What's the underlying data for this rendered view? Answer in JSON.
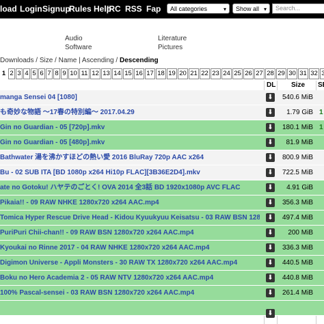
{
  "nav": [
    "load",
    "Login",
    "Signup",
    "Rules Help",
    "IRC",
    "RSS",
    "Fap"
  ],
  "filters": {
    "category": "All categories",
    "show": "Show all",
    "search_placeholder": "Search..."
  },
  "categories": [
    "Audio",
    "Software",
    "Literature",
    "Pictures"
  ],
  "breadcrumb": {
    "parts": [
      "Downloads",
      "Size",
      "Name",
      "Ascending"
    ],
    "current": "Descending"
  },
  "pages": [
    "1",
    "2",
    "3",
    "4",
    "5",
    "6",
    "7",
    "8",
    "9",
    "10",
    "11",
    "12",
    "13",
    "14",
    "15",
    "16",
    "17",
    "18",
    "19",
    "20",
    "21",
    "22",
    "23",
    "24",
    "25",
    "26",
    "27",
    "28",
    "29",
    "30",
    "31",
    "32",
    "33"
  ],
  "table": {
    "headers": {
      "dl": "DL",
      "size": "Size",
      "seed": "SE"
    },
    "rows": [
      {
        "name": "manga Sensei 04 [1080]",
        "size": "540.6 MiB",
        "seed": "",
        "style": "white"
      },
      {
        "name": "も奇妙な物語 ～17春の特別編～ 2017.04.29",
        "size": "1.79 GiB",
        "seed": "1",
        "style": "white"
      },
      {
        "name": "Gin no Guardian - 05 [720p].mkv",
        "size": "180.1 MiB",
        "seed": "1",
        "style": "green"
      },
      {
        "name": "Gin no Guardian - 05 [480p].mkv",
        "size": "81.9 MiB",
        "seed": "",
        "style": "green"
      },
      {
        "name": "Bathwater 湯を沸かすほどの熱い愛 2016 BluRay 720p AAC x264",
        "size": "800.9 MiB",
        "seed": "",
        "style": "white"
      },
      {
        "name": "Bu - 02 SUB ITA [BD 1080p x264 Hi10p FLAC][3B36E2D4].mkv",
        "size": "722.5 MiB",
        "seed": "",
        "style": "white"
      },
      {
        "name": "ate no Gotoku! ハヤテのごとく! OVA 2014 全3話 BD 1920x1080p AVC FLAC",
        "size": "4.91 GiB",
        "seed": "",
        "style": "green"
      },
      {
        "name": "Pikaia!! - 09 RAW NHKE 1280x720 x264 AAC.mp4",
        "size": "356.3 MiB",
        "seed": "",
        "style": "green"
      },
      {
        "name": "Tomica Hyper Rescue Drive Head - Kidou Kyuukyuu Keisatsu - 03 RAW BSN 1280x720 x264",
        "size": "497.4 MiB",
        "seed": "",
        "style": "green"
      },
      {
        "name": "PuriPuri Chii-chan!! - 09 RAW BSN 1280x720 x264 AAC.mp4",
        "size": "200 MiB",
        "seed": "",
        "style": "green"
      },
      {
        "name": "Kyoukai no Rinne 2017 - 04 RAW NHKE 1280x720 x264 AAC.mp4",
        "size": "336.3 MiB",
        "seed": "",
        "style": "green"
      },
      {
        "name": "Digimon Universe - Appli Monsters - 30 RAW TX 1280x720 x264 AAC.mp4",
        "size": "440.5 MiB",
        "seed": "",
        "style": "green"
      },
      {
        "name": "Boku no Hero Academia 2 - 05 RAW NTV 1280x720 x264 AAC.mp4",
        "size": "440.8 MiB",
        "seed": "",
        "style": "green"
      },
      {
        "name": "100% Pascal-sensei - 03 RAW BSN 1280x720 x264 AAC.mp4",
        "size": "261.4 MiB",
        "seed": "",
        "style": "green"
      },
      {
        "name": "",
        "size": "",
        "seed": "",
        "style": "green"
      }
    ]
  },
  "colors": {
    "green_row": "#96dc9b",
    "link": "#2c4aa8",
    "topbar": "#000000"
  }
}
